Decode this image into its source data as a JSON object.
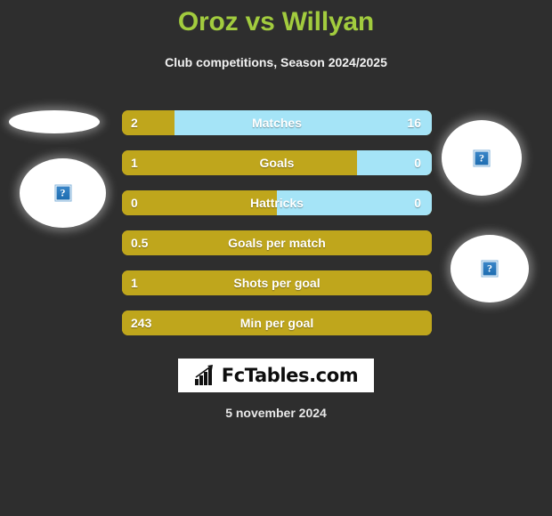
{
  "header": {
    "title": "Oroz vs Willyan",
    "subtitle": "Club competitions, Season 2024/2025"
  },
  "colors": {
    "background": "#2e2e2e",
    "title_green": "#a2cc3e",
    "bar_gold": "#bfa61c",
    "bar_cyan": "#a5e4f7",
    "text_white": "#ffffff"
  },
  "placeholders": [
    {
      "name": "player-left-flag-placeholder",
      "side": "left",
      "icon": "broken-image-icon",
      "glyph": "?"
    },
    {
      "name": "player-left-photo-placeholder",
      "side": "left",
      "icon": "broken-image-icon",
      "glyph": "?"
    },
    {
      "name": "player-right-flag-placeholder",
      "side": "right",
      "icon": "broken-image-icon",
      "glyph": "?"
    },
    {
      "name": "player-right-photo-placeholder",
      "side": "right",
      "icon": "broken-image-icon",
      "glyph": "?"
    }
  ],
  "chart_data": {
    "type": "bar",
    "title": "Oroz vs Willyan",
    "subtitle": "Club competitions, Season 2024/2025",
    "orientation": "horizontal-diverging",
    "series": [
      {
        "name": "Oroz",
        "color": "#bfa61c"
      },
      {
        "name": "Willyan",
        "color": "#a5e4f7"
      }
    ],
    "categories": [
      "Matches",
      "Goals",
      "Hattricks",
      "Goals per match",
      "Shots per goal",
      "Min per goal"
    ],
    "rows": [
      {
        "label": "Matches",
        "left_value": "2",
        "right_value": "16",
        "left_pct": 17,
        "split": true
      },
      {
        "label": "Goals",
        "left_value": "1",
        "right_value": "0",
        "left_pct": 76,
        "split": true
      },
      {
        "label": "Hattricks",
        "left_value": "0",
        "right_value": "0",
        "left_pct": 50,
        "split": true
      },
      {
        "label": "Goals per match",
        "left_value": "0.5",
        "right_value": "",
        "left_pct": 100,
        "split": false
      },
      {
        "label": "Shots per goal",
        "left_value": "1",
        "right_value": "",
        "left_pct": 100,
        "split": false
      },
      {
        "label": "Min per goal",
        "left_value": "243",
        "right_value": "",
        "left_pct": 100,
        "split": false
      }
    ]
  },
  "footer": {
    "logo_text": "FcTables.com",
    "logo_icon": "bar-chart-growth-icon",
    "date": "5 november 2024"
  }
}
